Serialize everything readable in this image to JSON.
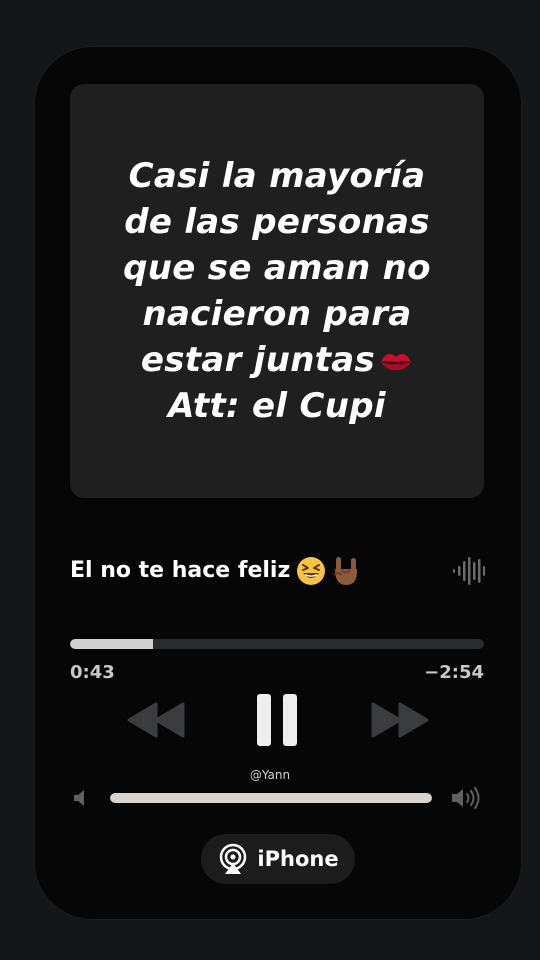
{
  "artwork": {
    "quote_lines": [
      "Casi la mayoría",
      "de las personas",
      "que se aman no",
      "nacieron para",
      "estar juntas",
      "Att: el Cupi"
    ],
    "quote_emoji": "kiss-mark-icon"
  },
  "now_playing": {
    "title": "El no te hace feliz",
    "emojis": [
      "grinning-squinting-face-icon",
      "sign-of-horns-icon"
    ]
  },
  "progress": {
    "elapsed": "0:43",
    "remaining": "−2:54",
    "fraction": 0.2
  },
  "controls": {
    "rewind_icon": "rewind-icon",
    "pause_icon": "pause-icon",
    "forward_icon": "fast-forward-icon"
  },
  "handle": "@Yann",
  "volume": {
    "level": 1.0,
    "low_icon": "volume-low-icon",
    "high_icon": "volume-high-icon"
  },
  "output": {
    "label": "iPhone",
    "icon": "airplay-icon"
  },
  "colors": {
    "background": "#141617",
    "card": "#060606",
    "artwork": "#1f1f1f",
    "progress_fill": "#cfcfcf",
    "track": "#2a2b2c",
    "kiss": "#c8102e"
  }
}
